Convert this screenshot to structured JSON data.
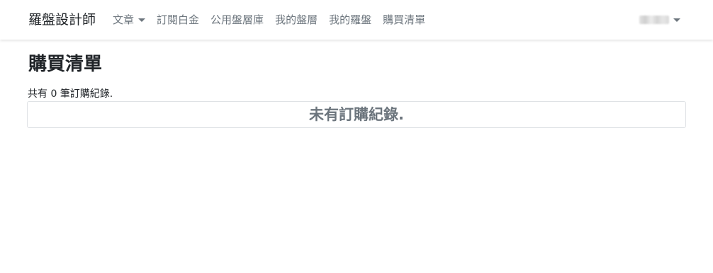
{
  "navbar": {
    "brand": "羅盤設計師",
    "links": [
      {
        "label": "文章",
        "has_dropdown": true
      },
      {
        "label": "訂閱白金"
      },
      {
        "label": "公用盤層庫"
      },
      {
        "label": "我的盤層"
      },
      {
        "label": "我的羅盤"
      },
      {
        "label": "購買清單"
      }
    ],
    "user_menu": {
      "has_dropdown": true
    }
  },
  "page": {
    "title": "購買清單",
    "summary": "共有 0 筆訂購紀錄.",
    "empty_message": "未有訂購紀錄."
  },
  "colors": {
    "nav_text": "#6c757d",
    "brand_text": "#212529",
    "empty_text": "#6c757d",
    "border": "#dfe2e5"
  }
}
